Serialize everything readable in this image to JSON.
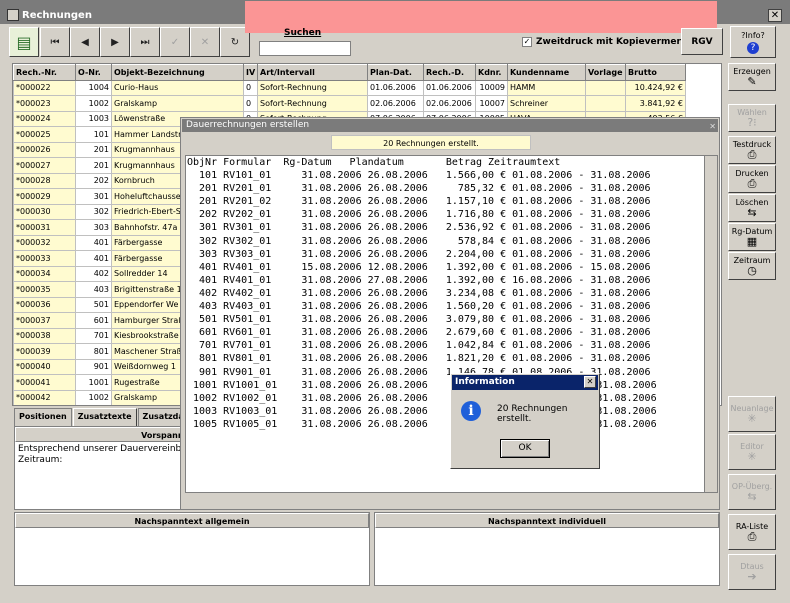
{
  "window": {
    "title": "Rechnungen"
  },
  "toolbar": {
    "search_label": "Suchen",
    "search_value": "",
    "checkbox_label": "Zweitdruck mit Kopievermerk",
    "rgv_label": "RGV",
    "info_label": "?Info?",
    "nav": [
      "first",
      "prev",
      "next",
      "last",
      "confirm",
      "cancel",
      "refresh"
    ]
  },
  "table": {
    "headers": [
      "Rech.-Nr.",
      "O-Nr.",
      "Objekt-Bezeichnung",
      "IV",
      "Art/Intervall",
      "Plan-Dat.",
      "Rech.-D.",
      "Kdnr.",
      "Kundenname",
      "Vorlage",
      "Brutto"
    ],
    "rows": [
      {
        "nr": "*000022",
        "onr": "1004",
        "obj": "Curio-Haus",
        "iv": "0",
        "art": "Sofort-Rechnung",
        "plan": "01.06.2006",
        "rech": "01.06.2006",
        "kd": "10009",
        "name": "HAMM",
        "vorlage": "",
        "brutto": "10.424,92 €"
      },
      {
        "nr": "*000023",
        "onr": "1002",
        "obj": "Gralskamp",
        "iv": "0",
        "art": "Sofort-Rechnung",
        "plan": "02.06.2006",
        "rech": "02.06.2006",
        "kd": "10007",
        "name": "Schreiner",
        "vorlage": "",
        "brutto": "3.841,92 €"
      },
      {
        "nr": "*000024",
        "onr": "1003",
        "obj": "Löwenstraße",
        "iv": "0",
        "art": "Sofort-Rechnung",
        "plan": "07.06.2006",
        "rech": "07.06.2006",
        "kd": "10005",
        "name": "HAVA",
        "vorlage": "",
        "brutto": "493,56 €"
      },
      {
        "nr": "*000025",
        "onr": "101",
        "obj": "Hammer Landstr"
      },
      {
        "nr": "*000026",
        "onr": "201",
        "obj": "Krugmannhaus"
      },
      {
        "nr": "*000027",
        "onr": "201",
        "obj": "Krugmannhaus"
      },
      {
        "nr": "*000028",
        "onr": "202",
        "obj": "Kornbruch"
      },
      {
        "nr": "*000029",
        "onr": "301",
        "obj": "Hoheluftchausse"
      },
      {
        "nr": "*000030",
        "onr": "302",
        "obj": "Friedrich-Ebert-S"
      },
      {
        "nr": "*000031",
        "onr": "303",
        "obj": "Bahnhofstr. 47a"
      },
      {
        "nr": "*000032",
        "onr": "401",
        "obj": "Färbergasse"
      },
      {
        "nr": "*000033",
        "onr": "401",
        "obj": "Färbergasse"
      },
      {
        "nr": "*000034",
        "onr": "402",
        "obj": "Sollredder 14"
      },
      {
        "nr": "*000035",
        "onr": "403",
        "obj": "Brigittenstraße 1"
      },
      {
        "nr": "*000036",
        "onr": "501",
        "obj": "Eppendorfer We"
      },
      {
        "nr": "*000037",
        "onr": "601",
        "obj": "Hamburger Straß"
      },
      {
        "nr": "*000038",
        "onr": "701",
        "obj": "Kiesbrookstraße"
      },
      {
        "nr": "*000039",
        "onr": "801",
        "obj": "Maschener Straß"
      },
      {
        "nr": "*000040",
        "onr": "901",
        "obj": "Weißdornweg 1"
      },
      {
        "nr": "*000041",
        "onr": "1001",
        "obj": "Rugestraße"
      },
      {
        "nr": "*000042",
        "onr": "1002",
        "obj": "Gralskamp"
      },
      {
        "nr": "*000043",
        "onr": "1003",
        "obj": "Löwenstraße"
      }
    ]
  },
  "tabs": [
    "Positionen",
    "Zusatztexte",
    "Zusatzda"
  ],
  "vorspann": {
    "header": "Vorspanntext allgem",
    "text": "Entsprechend unserer Dauervereinb\nZeitraum:"
  },
  "nachspann": {
    "allgemein": "Nachspanntext allgemein",
    "individuell": "Nachspanntext individuell"
  },
  "side": [
    {
      "label": "Erzeugen",
      "icon": "✎",
      "dis": false
    },
    {
      "label": "Wählen",
      "icon": "?⁝",
      "dis": true
    },
    {
      "label": "Testdruck",
      "icon": "⎙",
      "dis": false
    },
    {
      "label": "Drucken",
      "icon": "⎙",
      "dis": false
    },
    {
      "label": "Löschen",
      "icon": "⇆",
      "dis": false
    },
    {
      "label": "Rg-Datum",
      "icon": "▦",
      "dis": false
    },
    {
      "label": "Zeitraum",
      "icon": "◷",
      "dis": false
    },
    {
      "label": "Neuanlage",
      "icon": "✳",
      "dis": true
    },
    {
      "label": "Editor",
      "icon": "✳",
      "dis": true
    },
    {
      "label": "OP-Überg.",
      "icon": "⇆",
      "dis": true
    },
    {
      "label": "RA-Liste",
      "icon": "⎙",
      "dis": false
    },
    {
      "label": "Dtaus",
      "icon": "➔",
      "dis": true
    }
  ],
  "dauer": {
    "title": "Dauerrechnungen erstellen",
    "message": "20 Rechnungen erstellt.",
    "header": "ObjNr Formular  Rg-Datum   Plandatum       Betrag Zeitraumtext",
    "lines": [
      "  101 RV101_01     31.08.2006 26.08.2006   1.566,00 € 01.08.2006 - 31.08.2006",
      "  201 RV201_01     31.08.2006 26.08.2006     785,32 € 01.08.2006 - 31.08.2006",
      "  201 RV201_02     31.08.2006 26.08.2006   1.157,10 € 01.08.2006 - 31.08.2006",
      "  202 RV202_01     31.08.2006 26.08.2006   1.716,80 € 01.08.2006 - 31.08.2006",
      "  301 RV301_01     31.08.2006 26.08.2006   2.536,92 € 01.08.2006 - 31.08.2006",
      "  302 RV302_01     31.08.2006 26.08.2006     578,84 € 01.08.2006 - 31.08.2006",
      "  303 RV303_01     31.08.2006 26.08.2006   2.204,00 € 01.08.2006 - 31.08.2006",
      "  401 RV401_01     15.08.2006 12.08.2006   1.392,00 € 01.08.2006 - 15.08.2006",
      "  401 RV401_01     31.08.2006 27.08.2006   1.392,00 € 16.08.2006 - 31.08.2006",
      "  402 RV402_01     31.08.2006 26.08.2006   3.234,08 € 01.08.2006 - 31.08.2006",
      "  403 RV403_01     31.08.2006 26.08.2006   1.560,20 € 01.08.2006 - 31.08.2006",
      "  501 RV501_01     31.08.2006 26.08.2006   3.079,80 € 01.08.2006 - 31.08.2006",
      "  601 RV601_01     31.08.2006 26.08.2006   2.679,60 € 01.08.2006 - 31.08.2006",
      "  701 RV701_01     31.08.2006 26.08.2006   1.042,84 € 01.08.2006 - 31.08.2006",
      "  801 RV801_01     31.08.2006 26.08.2006   1.821,20 € 01.08.2006 - 31.08.2006",
      "  901 RV901_01     31.08.2006 26.08.2006   1.146,78 € 01.08.2006 - 31.08.2006",
      " 1001 RV1001_01    31.08.2006 26.08.2006                          - 31.08.2006",
      " 1002 RV1002_01    31.08.2006 26.08.2006                          - 31.08.2006",
      " 1003 RV1003_01    31.08.2006 26.08.2006                          - 31.08.2006",
      " 1005 RV1005_01    31.08.2006 26.08.2006                          - 31.08.2006"
    ]
  },
  "infodlg": {
    "title": "Information",
    "text": "20 Rechnungen erstellt.",
    "ok": "OK"
  }
}
